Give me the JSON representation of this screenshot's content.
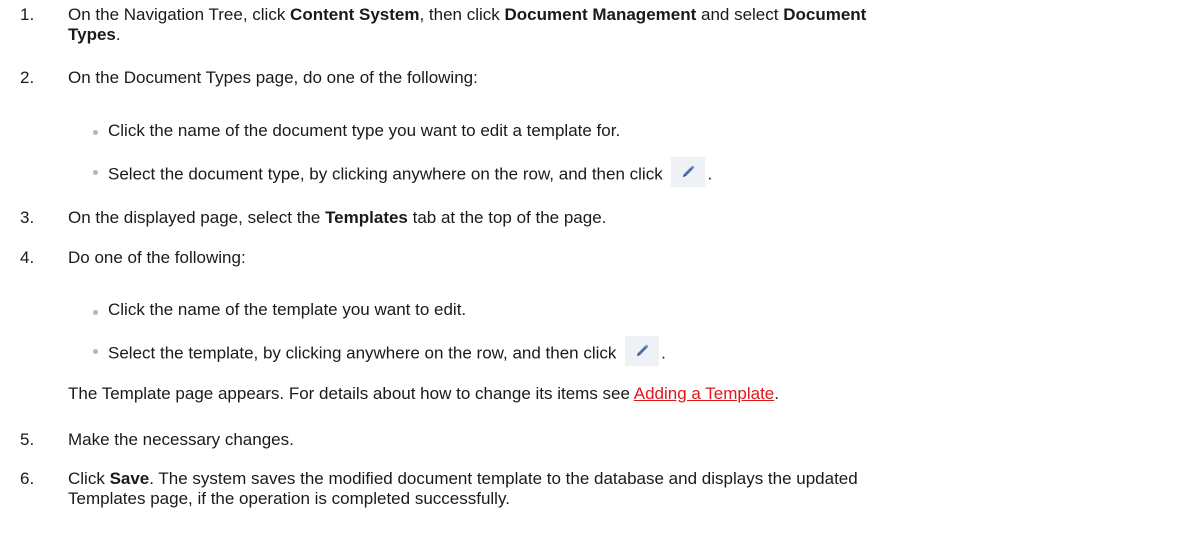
{
  "steps": [
    {
      "num": "1.",
      "parts": [
        "On the Navigation Tree, click ",
        "Content System",
        ", then click ",
        "Document Management",
        " and select ",
        "Document",
        "Types",
        "."
      ]
    },
    {
      "num": "2.",
      "text": "On the Document Types page, do one of the following:",
      "bullets": [
        "Click the name of the document type you want to edit a template for.",
        "Select the document type, by clicking anywhere on the row, and then click"
      ],
      "bullet2_end": "."
    },
    {
      "num": "3.",
      "parts": [
        "On the displayed page, select the ",
        "Templates",
        " tab at the top of the page."
      ]
    },
    {
      "num": "4.",
      "text": "Do one of the following:",
      "bullets": [
        "Click the name of the template you want to edit.",
        "Select the template, by clicking anywhere on the row, and then click"
      ],
      "bullet2_end": ".",
      "note_before": "The Template page appears. For details about how to change its items see ",
      "note_link": "Adding a Template",
      "note_after": "."
    },
    {
      "num": "5.",
      "text": "Make the necessary changes."
    },
    {
      "num": "6.",
      "parts": [
        "Click ",
        "Save",
        ". The system saves the modified document template to the database and displays the updated"
      ],
      "line2": "Templates page, if the operation is completed successfully."
    }
  ],
  "icons": {
    "edit": "pencil-edit-icon"
  },
  "colors": {
    "link": "#e0161b",
    "bullet": "#9ec7a8",
    "icon_bg": "#eef2f7",
    "icon_pencil": "#4a6fa5"
  }
}
